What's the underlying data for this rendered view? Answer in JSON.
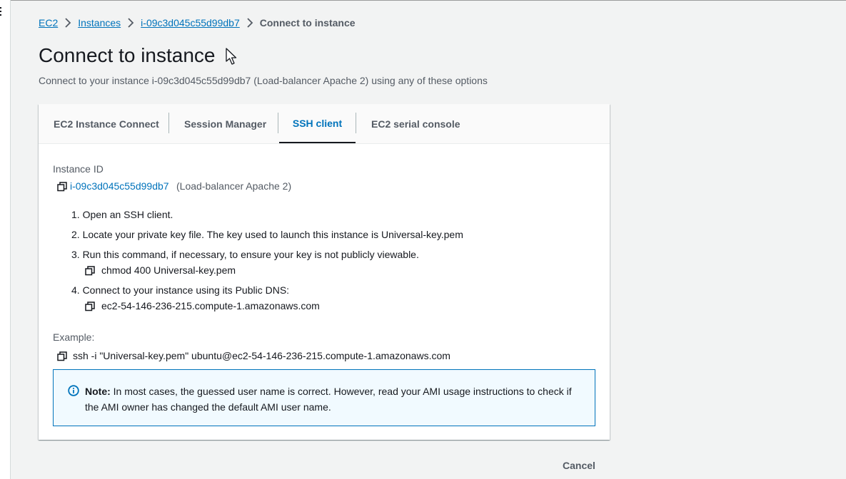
{
  "breadcrumb": {
    "items": [
      "EC2",
      "Instances",
      "i-09c3d045c55d99db7"
    ],
    "current": "Connect to instance"
  },
  "page": {
    "title": "Connect to instance",
    "subtitle": "Connect to your instance i-09c3d045c55d99db7 (Load-balancer Apache 2) using any of these options"
  },
  "tabs": [
    {
      "label": "EC2 Instance Connect",
      "active": false
    },
    {
      "label": "Session Manager",
      "active": false
    },
    {
      "label": "SSH client",
      "active": true
    },
    {
      "label": "EC2 serial console",
      "active": false
    }
  ],
  "ssh": {
    "instance_id_label": "Instance ID",
    "instance_id": "i-09c3d045c55d99db7",
    "instance_name": "(Load-balancer Apache 2)",
    "steps": [
      "1. Open an SSH client.",
      "2. Locate your private key file. The key used to launch this instance is Universal-key.pem",
      "3. Run this command, if necessary, to ensure your key is not publicly viewable.",
      "4. Connect to your instance using its Public DNS:"
    ],
    "chmod_command": "chmod 400 Universal-key.pem",
    "public_dns": "ec2-54-146-236-215.compute-1.amazonaws.com",
    "example_label": "Example:",
    "example_command": "ssh -i \"Universal-key.pem\" ubuntu@ec2-54-146-236-215.compute-1.amazonaws.com"
  },
  "note": {
    "label": "Note:",
    "text": " In most cases, the guessed user name is correct. However, read your AMI usage instructions to check if the AMI owner has changed the default AMI user name."
  },
  "footer": {
    "cancel_label": "Cancel"
  },
  "icons": {
    "copy": "copy-icon",
    "info": "info-icon",
    "chevron": "chevron-right-icon",
    "cursor": "mouse-pointer-icon"
  },
  "colors": {
    "link": "#0073bb",
    "note_border": "#0073bb",
    "note_bg": "#f1faff",
    "text_secondary": "#545b64"
  }
}
